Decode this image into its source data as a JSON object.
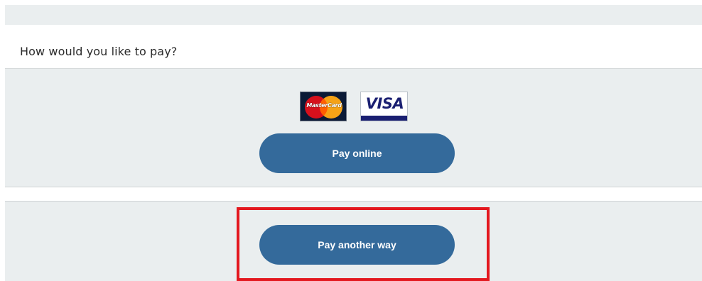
{
  "payment": {
    "question": "How would you like to pay?",
    "card_logos": [
      {
        "name": "mastercard-logo",
        "text": "MasterCard"
      },
      {
        "name": "visa-logo",
        "text": "VISA"
      }
    ],
    "pay_online_label": "Pay online",
    "pay_another_way_label": "Pay another way"
  },
  "colors": {
    "button": "#346a9b",
    "panel_background": "#eaeeef",
    "highlight": "#e3181f"
  },
  "annotation": {
    "highlighted_control": "Pay another way"
  }
}
